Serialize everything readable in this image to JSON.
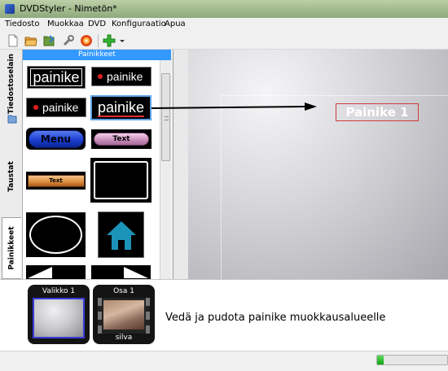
{
  "window": {
    "title": "DVDStyler - Nimetön*"
  },
  "menubar": {
    "items": [
      "Tiedosto",
      "Muokkaa",
      "DVD",
      "Konfiguraatio",
      "Apua"
    ]
  },
  "toolbar": {
    "icons": [
      "new-file-icon",
      "open-folder-icon",
      "save-icon",
      "settings-wrench-icon",
      "burn-disc-icon",
      "add-icon",
      "dropdown-arrow-icon"
    ]
  },
  "side_tabs": [
    "Tiedostoselain",
    "Taustat",
    "Painikkeet"
  ],
  "panel": {
    "header": "Painikkeet",
    "buttons": {
      "b1": "painike",
      "b2": "painike",
      "b3": "painike",
      "b4": "painike",
      "menu": "Menu",
      "text1": "Text",
      "text2": "Text"
    }
  },
  "canvas": {
    "button_label": "Painike 1"
  },
  "titles": [
    {
      "label": "Valikko 1",
      "sub": ""
    },
    {
      "label": "Osa 1",
      "sub": "silva"
    }
  ],
  "hint": "Vedä ja pudota painike muokkausalueelle",
  "status": {
    "progress": 0.09
  },
  "colors": {
    "panel_header": "#3399ff",
    "canvas_button_border": "#d23b3b",
    "progress": "#14a414"
  }
}
